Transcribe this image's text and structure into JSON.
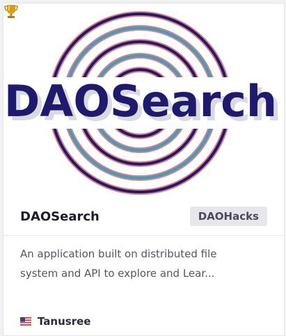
{
  "hero": {
    "logo_text": "DAOSearch",
    "trophy_icon": "trophy-icon",
    "colors": {
      "navy": "#1f1a6e",
      "teal": "#3a9fc2",
      "salmon": "#de7f82"
    }
  },
  "project": {
    "title": "DAOSearch",
    "badge": "DAOHacks",
    "description": "An application built on distributed file system and API to explore and Lear...",
    "author": "Tanusree",
    "author_flag_icon": "us-flag-icon"
  }
}
